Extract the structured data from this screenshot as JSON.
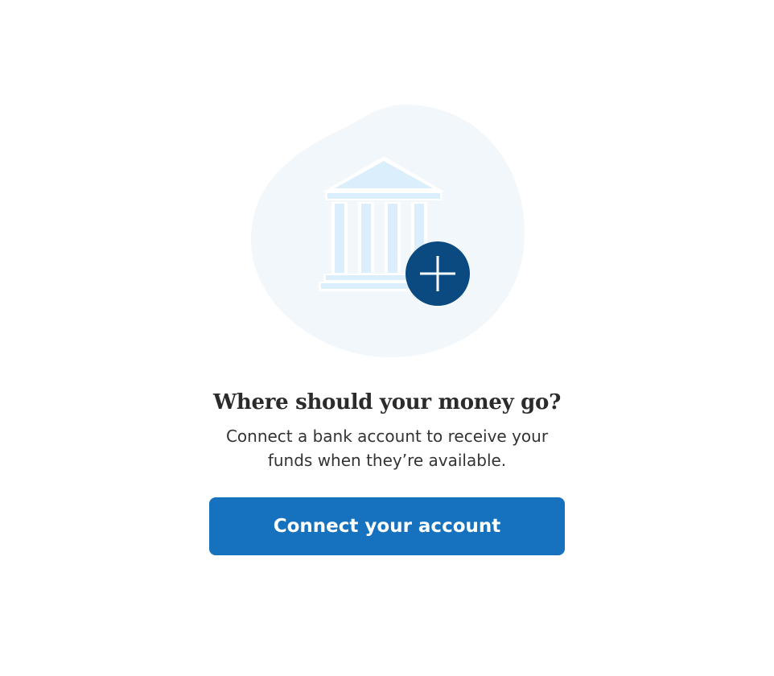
{
  "illustration": {
    "building_icon": "bank-icon",
    "badge_icon": "plus-icon",
    "blob_color": "#f2f7fc",
    "building_color": "#dbeefc",
    "badge_color": "#0b4a80"
  },
  "heading": "Where should your money go?",
  "subheading": "Connect a bank account to receive your funds when they’re available.",
  "cta": {
    "label": "Connect your account",
    "color": "#1672be"
  }
}
